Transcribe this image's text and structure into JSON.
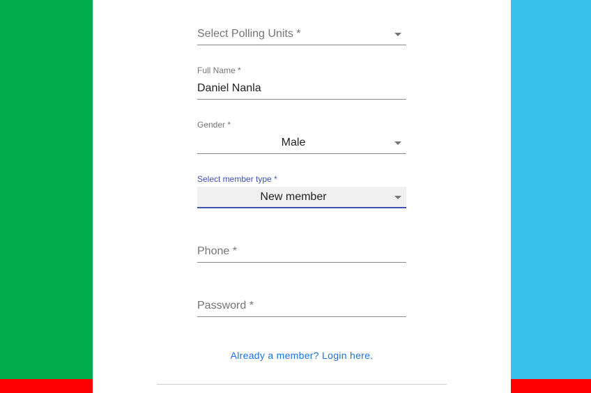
{
  "colors": {
    "stripe_left": "#00ab4a",
    "stripe_right": "#35c3ec",
    "stripe_red": "#ff0000",
    "focus_accent": "#3f51b5",
    "link": "#1a73e8"
  },
  "form": {
    "polling_unit": {
      "placeholder": "Select Polling Units *"
    },
    "full_name": {
      "label": "Full Name *",
      "value": "Daniel Nanla"
    },
    "gender": {
      "label": "Gender *",
      "value": "Male"
    },
    "member_type": {
      "label": "Select member type *",
      "value": "New member"
    },
    "phone": {
      "placeholder": "Phone *"
    },
    "password": {
      "placeholder": "Password *"
    }
  },
  "login_link": "Already a member? Login here."
}
